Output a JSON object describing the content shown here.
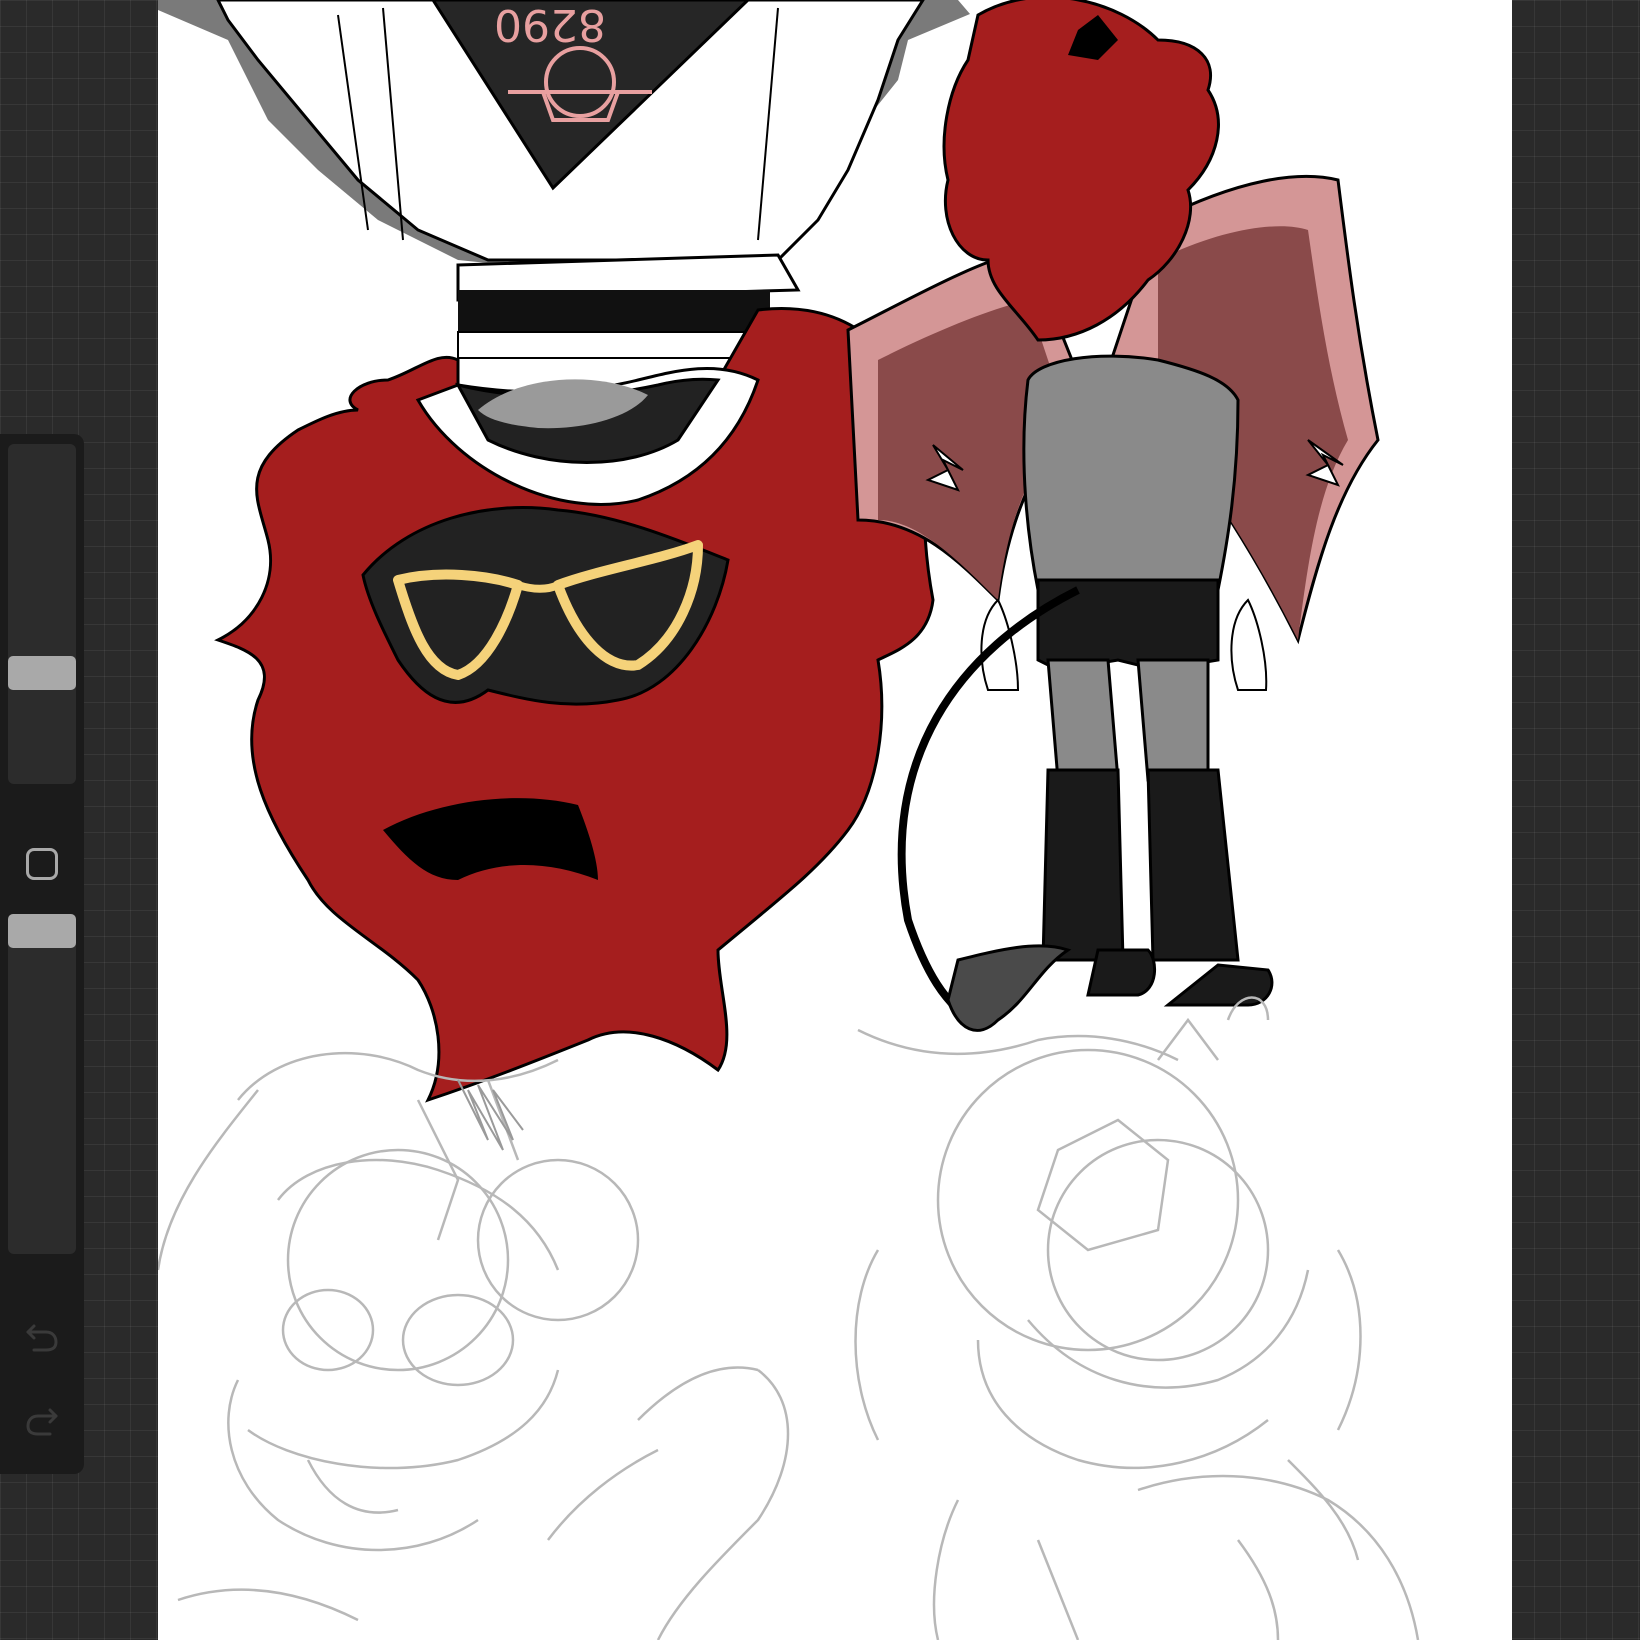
{
  "app": {
    "canvas_background": "#ffffff",
    "workspace_background": "#2a2a2a",
    "panel_color": "#1b1b1b"
  },
  "sidebar": {
    "brush_size": {
      "value": 0.4,
      "icon": "slider-thumb"
    },
    "modify_button": {
      "icon": "square-icon"
    },
    "brush_opacity": {
      "value": 0.05,
      "icon": "slider-thumb"
    },
    "undo": {
      "icon": "undo-icon"
    },
    "redo": {
      "icon": "redo-icon"
    }
  },
  "artwork": {
    "shirt_text": "8290",
    "colors": {
      "hair": "#a51e1e",
      "glasses": "#f5d27a",
      "wing_light": "#d49696",
      "wing_dark": "#8a4a4a",
      "shirt": "#8a8a8a",
      "sketch": "#b8b8b8",
      "pink_mark": "#e8a0a0"
    }
  }
}
